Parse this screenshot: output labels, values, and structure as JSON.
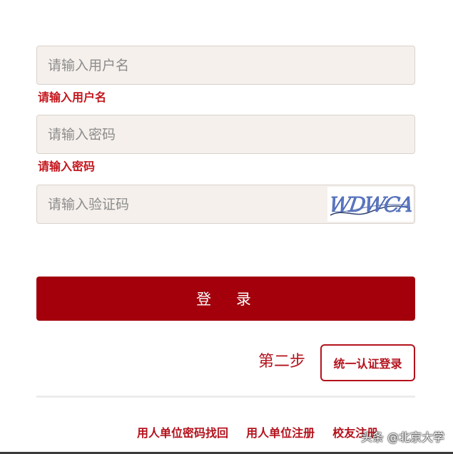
{
  "form": {
    "username": {
      "placeholder": "请输入用户名",
      "value": "",
      "error": "请输入用户名"
    },
    "password": {
      "placeholder": "请输入密码",
      "value": "",
      "error": "请输入密码"
    },
    "captcha": {
      "placeholder": "请输入验证码",
      "value": "",
      "image_text": "WDWCA"
    },
    "login_label": "登 录"
  },
  "second_step": {
    "label": "第二步",
    "sso_button": "统一认证登录"
  },
  "footer": {
    "links": [
      "用人单位密码找回",
      "用人单位注册",
      "校友注册"
    ],
    "watermark": "头条 @北京大学"
  },
  "colors": {
    "brand_red": "#a3000b",
    "error_red": "#c4161c",
    "field_bg": "#f5f0ec"
  }
}
